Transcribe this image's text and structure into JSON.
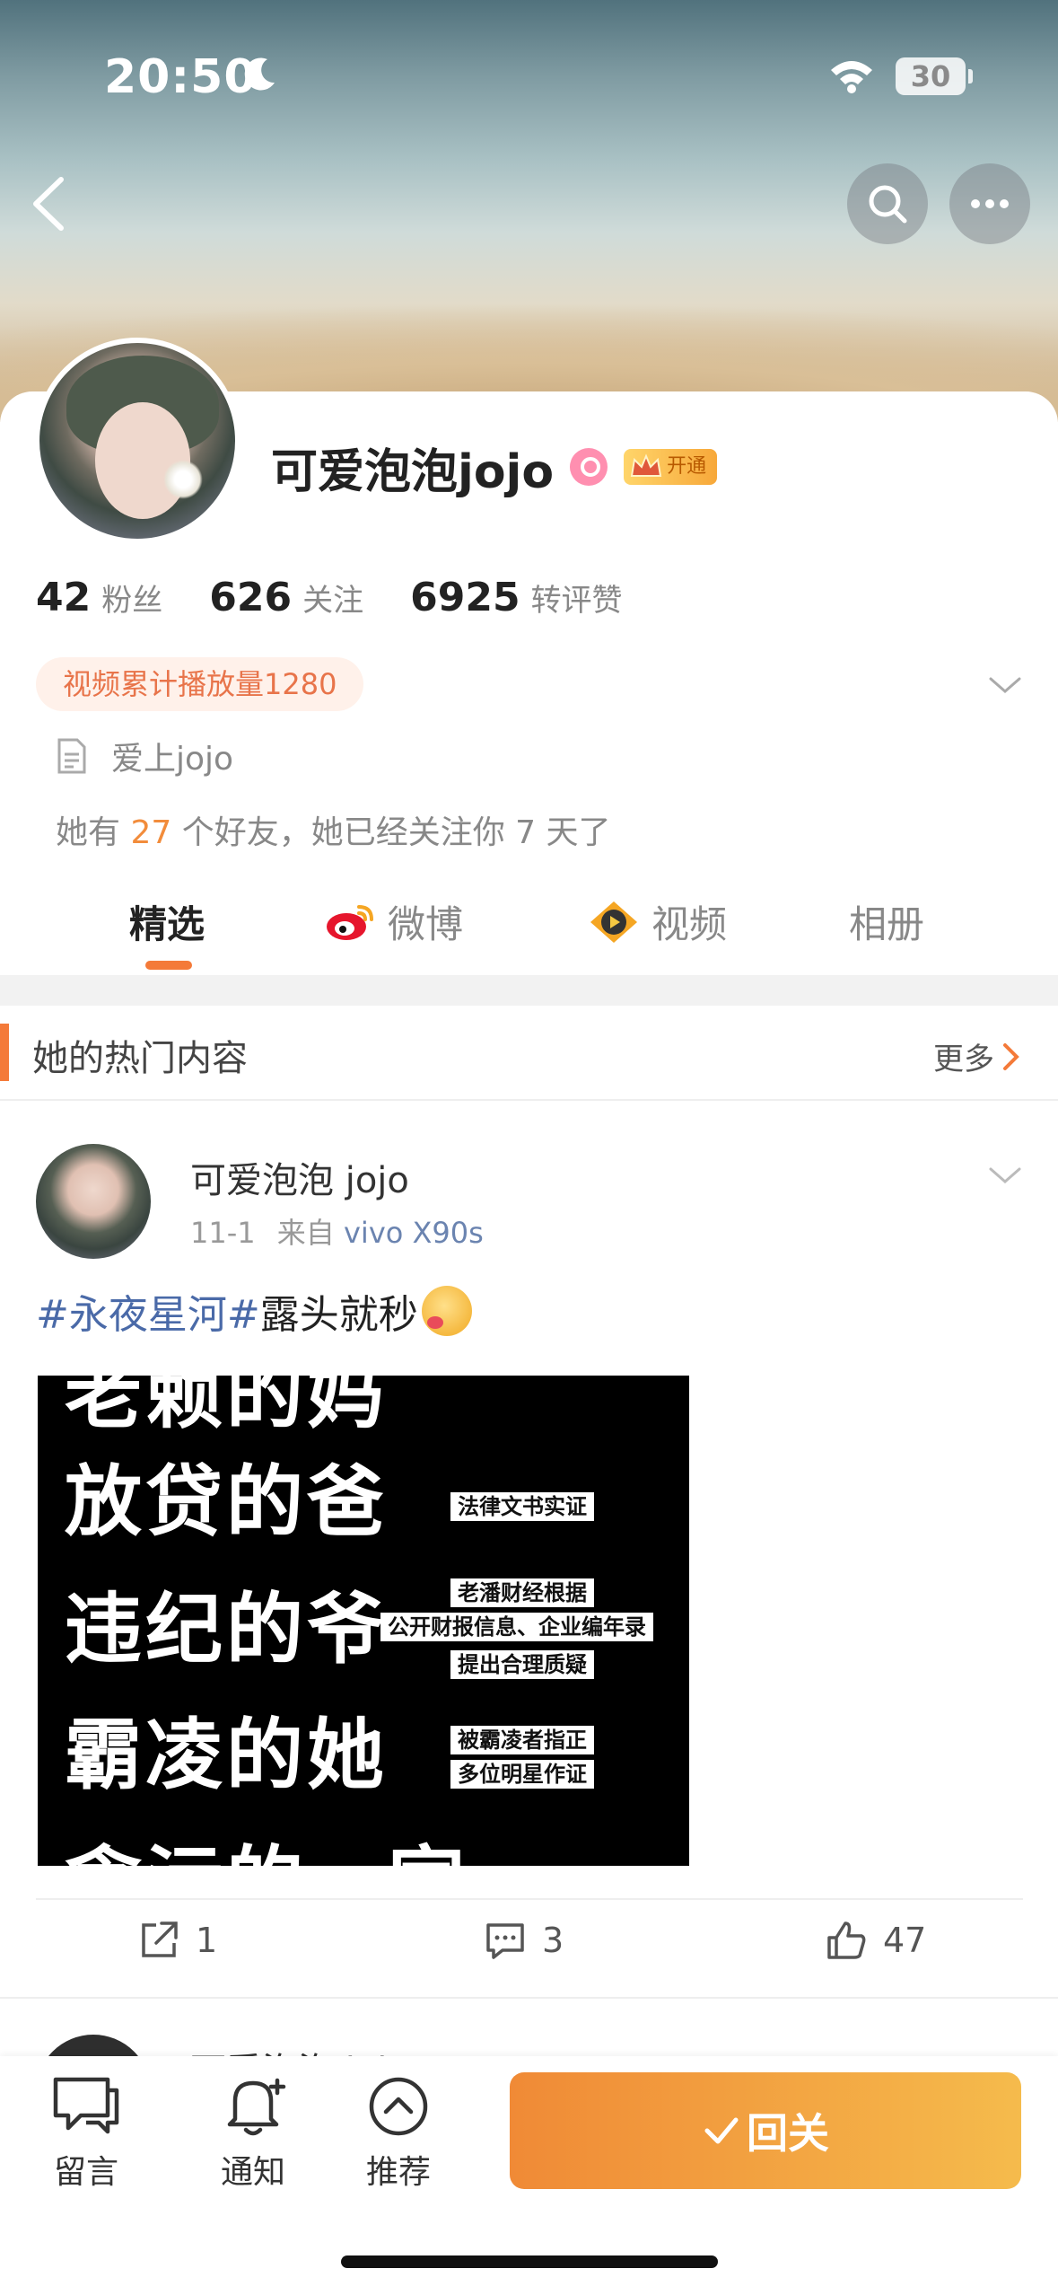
{
  "status_bar": {
    "time": "20:50",
    "battery": "30"
  },
  "profile": {
    "name": "可爱泡泡jojo",
    "open_badge": "开通",
    "stats": [
      {
        "value": "42",
        "label": "粉丝"
      },
      {
        "value": "626",
        "label": "关注"
      },
      {
        "value": "6925",
        "label": "转评赞"
      }
    ],
    "play_count": "视频累计播放量1280",
    "bio": "爱上jojo",
    "friends": {
      "prefix": "她有",
      "count": "27",
      "suffix": "个好友，她已经关注你 7 天了"
    }
  },
  "tabs": [
    {
      "label": "精选",
      "active": true
    },
    {
      "label": "微博",
      "icon": "weibo-icon"
    },
    {
      "label": "视频",
      "icon": "video-icon"
    },
    {
      "label": "相册"
    }
  ],
  "hot_section": {
    "title": "她的热门内容",
    "more": "更多"
  },
  "post": {
    "author": "可爱泡泡 jojo",
    "date": "11-1",
    "source_prefix": "来自",
    "device": "vivo X90s",
    "hashtag": "#永夜星河#",
    "text": "露头就秒",
    "image": {
      "lines": [
        "老赖的妈",
        "放贷的爸",
        "违纪的爷",
        "霸凌的她",
        "贪污的一家"
      ],
      "labels": [
        "法律文书实证",
        "老潘财经根据",
        "公开财报信息、企业编年录",
        "提出合理质疑",
        "被霸凌者指正",
        "多位明星作证"
      ]
    },
    "reposts": "1",
    "comments": "3",
    "likes": "47"
  },
  "next_post": {
    "author": "可爱泡泡 jojo"
  },
  "bottom_bar": {
    "message": "留言",
    "notify": "通知",
    "recommend": "推荐",
    "follow_back": "回关"
  },
  "colors": {
    "accent": "#f47a39",
    "link": "#4a6aa8",
    "follow_gradient": [
      "#f08a36",
      "#f5bb4c"
    ]
  }
}
